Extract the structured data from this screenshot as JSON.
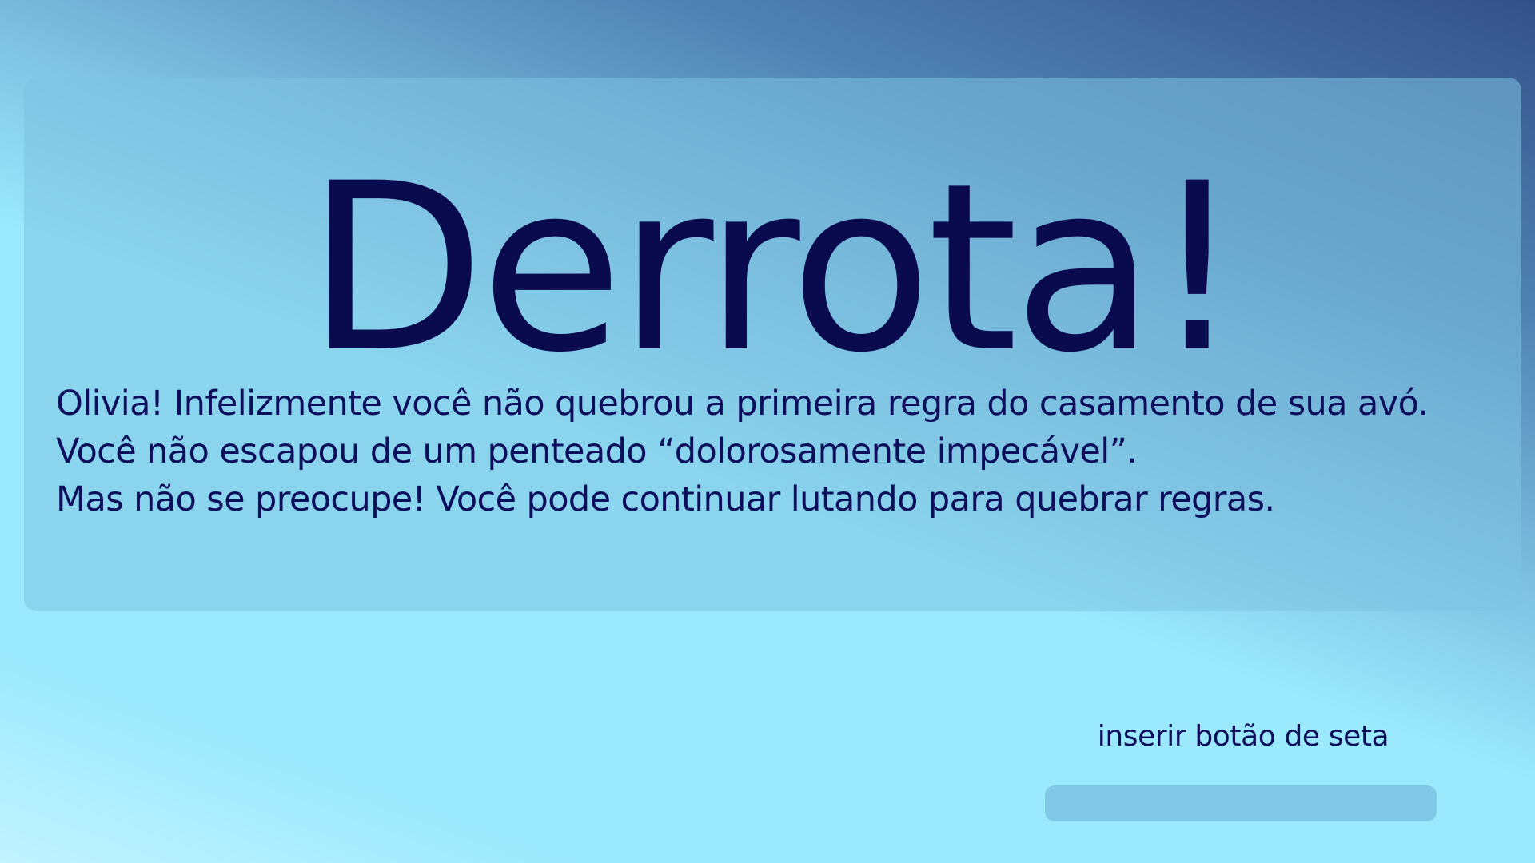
{
  "screen": {
    "title": "Derrota!",
    "message_lines": [
      "Olivia! Infelizmente você não quebrou a primeira regra do casamento de sua avó.",
      "Você não escapou de um penteado “dolorosamente impecável”.",
      "Mas não se preocupe! Você pode continuar lutando para quebrar regras."
    ],
    "arrow_placeholder_label": "inserir botão de seta"
  },
  "colors": {
    "text_dark": "#0a0b4f",
    "panel": "#7dc3e1",
    "background_light": "#9be9fd",
    "background_dark": "#34508a",
    "button": "#80c8e6"
  }
}
